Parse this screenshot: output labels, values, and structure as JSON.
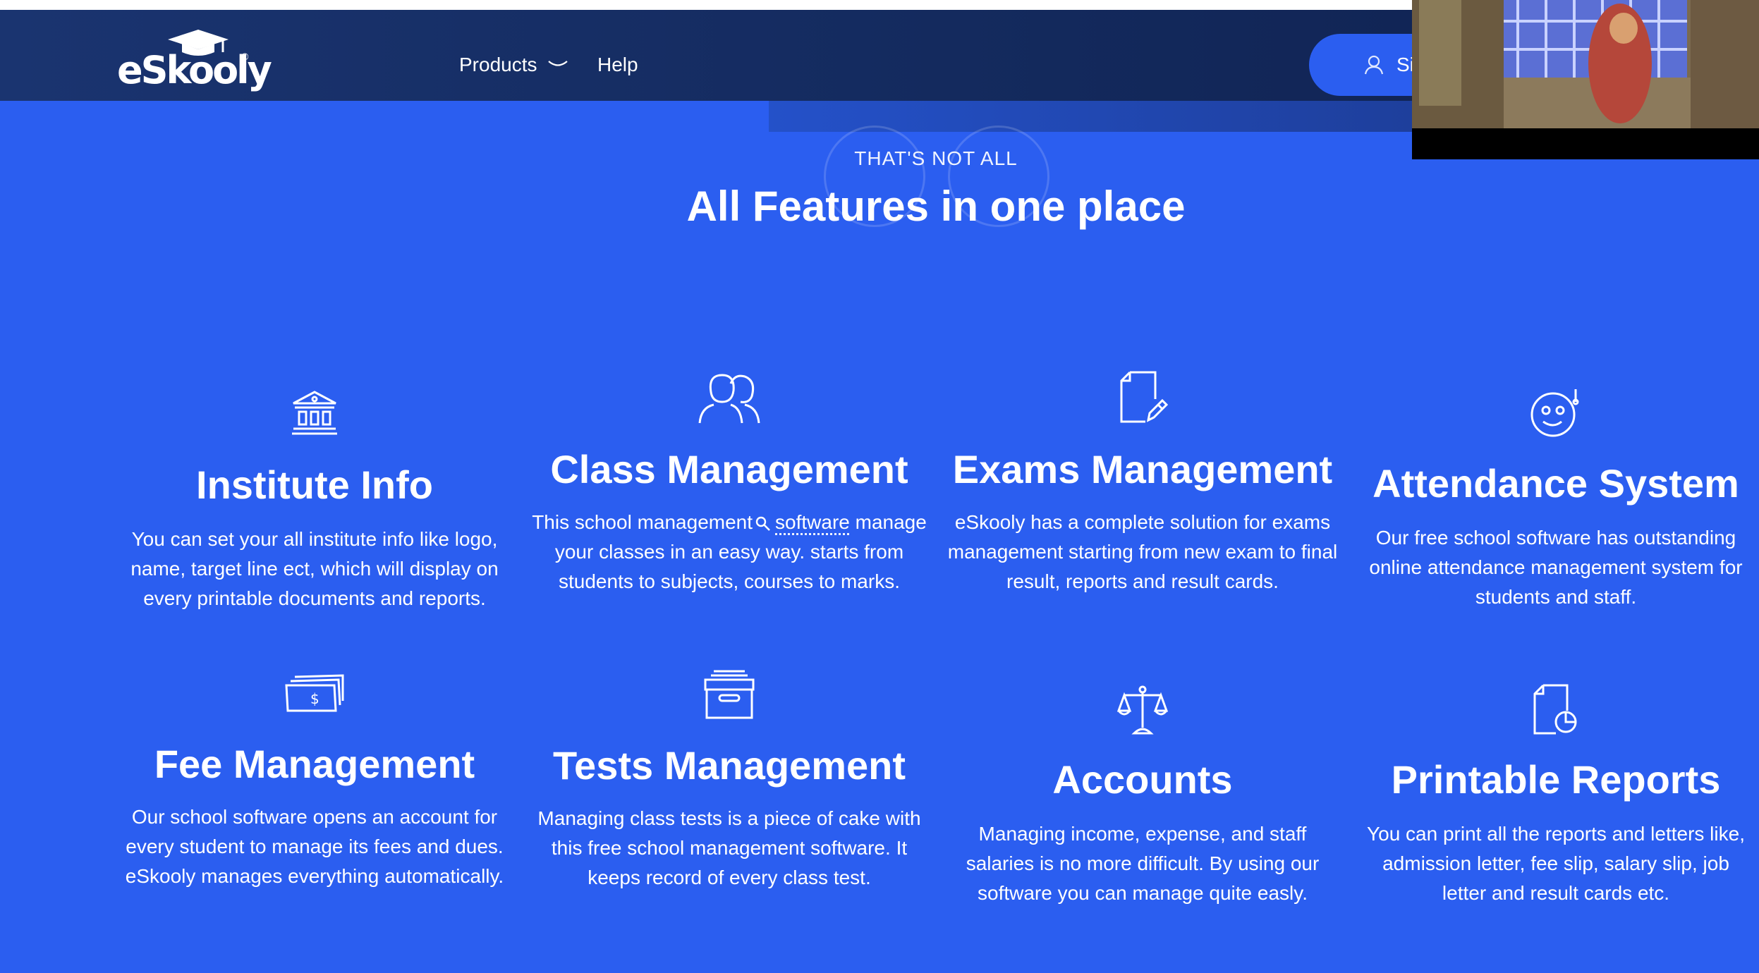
{
  "nav": {
    "logo_text": "eSkooly",
    "products_label": "Products",
    "help_label": "Help",
    "signin_label": "Si"
  },
  "section": {
    "eyebrow": "THAT'S NOT ALL",
    "title": "All Features in one place"
  },
  "features": [
    {
      "icon": "bank-building-icon",
      "title": "Institute Info",
      "description": "You can set your all institute info like logo, name, target line ect, which will display on every printable documents and reports."
    },
    {
      "icon": "people-icon",
      "title": "Class Management",
      "description_before": "This school management",
      "description_link": "software",
      "description_after": "manage your classes in an easy way. starts from students to subjects, courses to marks."
    },
    {
      "icon": "document-pen-icon",
      "title": "Exams Management",
      "description": "eSkooly has a complete solution for exams management starting from new exam to final result, reports and result cards."
    },
    {
      "icon": "smiley-face-icon",
      "title": "Attendance System",
      "description": "Our free school software has outstanding online attendance management system for students and staff."
    },
    {
      "icon": "money-stack-icon",
      "title": "Fee Management",
      "description": "Our school software opens an account for every student to manage its fees and dues. eSkooly manages everything automatically."
    },
    {
      "icon": "archive-box-icon",
      "title": "Tests Management",
      "description": "Managing class tests is a piece of cake with this free school management software. It keeps record of every class test."
    },
    {
      "icon": "balance-scale-icon",
      "title": "Accounts",
      "description": "Managing income, expense, and staff salaries is no more difficult. By using our software you can manage quite easly."
    },
    {
      "icon": "report-chart-icon",
      "title": "Printable Reports",
      "description": "You can print all the reports and letters like, admission letter, fee slip, salary slip, job letter and result cards etc."
    }
  ],
  "colors": {
    "background": "#2b5ef0",
    "navbar": "#13295c",
    "text": "#ffffff"
  }
}
